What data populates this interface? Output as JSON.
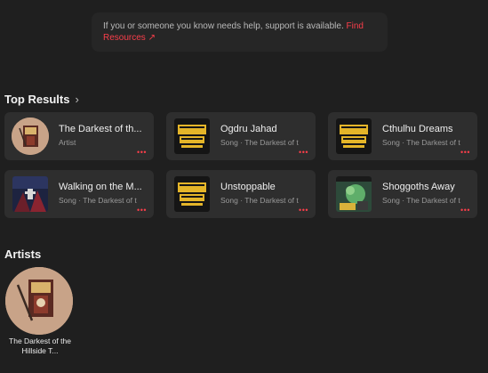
{
  "banner": {
    "text": "If you or someone you know needs help, support is available.",
    "link": "Find Resources ↗"
  },
  "top_results": {
    "title": "Top Results",
    "chevron": "›",
    "items": [
      {
        "title": "The Darkest of th...",
        "subtitle": "Artist",
        "art": "artist-portrait"
      },
      {
        "title": "Ogdru Jahad",
        "subtitle": "Song · The Darkest of t",
        "art": "cthulhu-strikes-back-cover"
      },
      {
        "title": "Cthulhu Dreams",
        "subtitle": "Song · The Darkest of t",
        "art": "cthulhu-strikes-back-cover"
      },
      {
        "title": "Walking on the M...",
        "subtitle": "Song · The Darkest of t",
        "art": "album-cover-dark"
      },
      {
        "title": "Unstoppable",
        "subtitle": "Song · The Darkest of t",
        "art": "cthulhu-strikes-back-cover"
      },
      {
        "title": "Shoggoths Away",
        "subtitle": "Song · The Darkest of t",
        "art": "album-cover-green"
      }
    ],
    "more_label": "•••"
  },
  "artists": {
    "title": "Artists",
    "items": [
      {
        "name": "The Darkest of the Hillside T..."
      }
    ]
  },
  "colors": {
    "accent": "#fa3e4a",
    "background": "#1f1f1f",
    "card": "#2e2e2e"
  }
}
